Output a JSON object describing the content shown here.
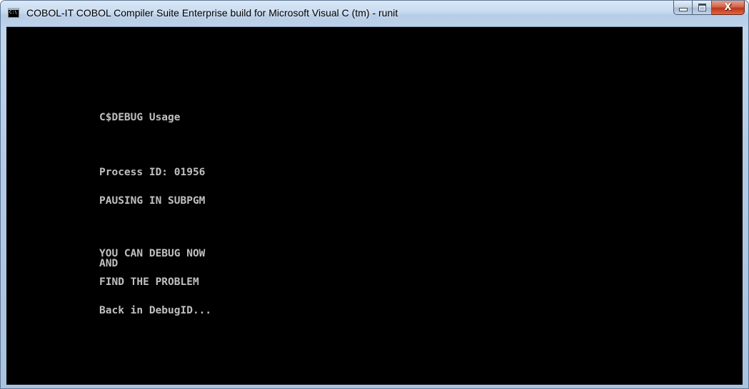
{
  "window": {
    "title": "COBOL-IT COBOL Compiler Suite Enterprise build for Microsoft Visual C (tm) - runit",
    "icon": "console-app-icon",
    "icon_glyph": "C:\\",
    "controls": {
      "minimize_icon": "minimize-icon",
      "maximize_icon": "maximize-icon",
      "close_icon": "close-icon",
      "close_glyph": "X"
    }
  },
  "console": {
    "background": "#000000",
    "text_color": "#c0c0c0",
    "lines": [
      "C$DEBUG Usage",
      "Process ID: 01956",
      "PAUSING IN SUBPGM",
      "YOU CAN DEBUG NOW",
      "AND",
      "FIND THE PROBLEM",
      "Back in DebugID..."
    ]
  }
}
